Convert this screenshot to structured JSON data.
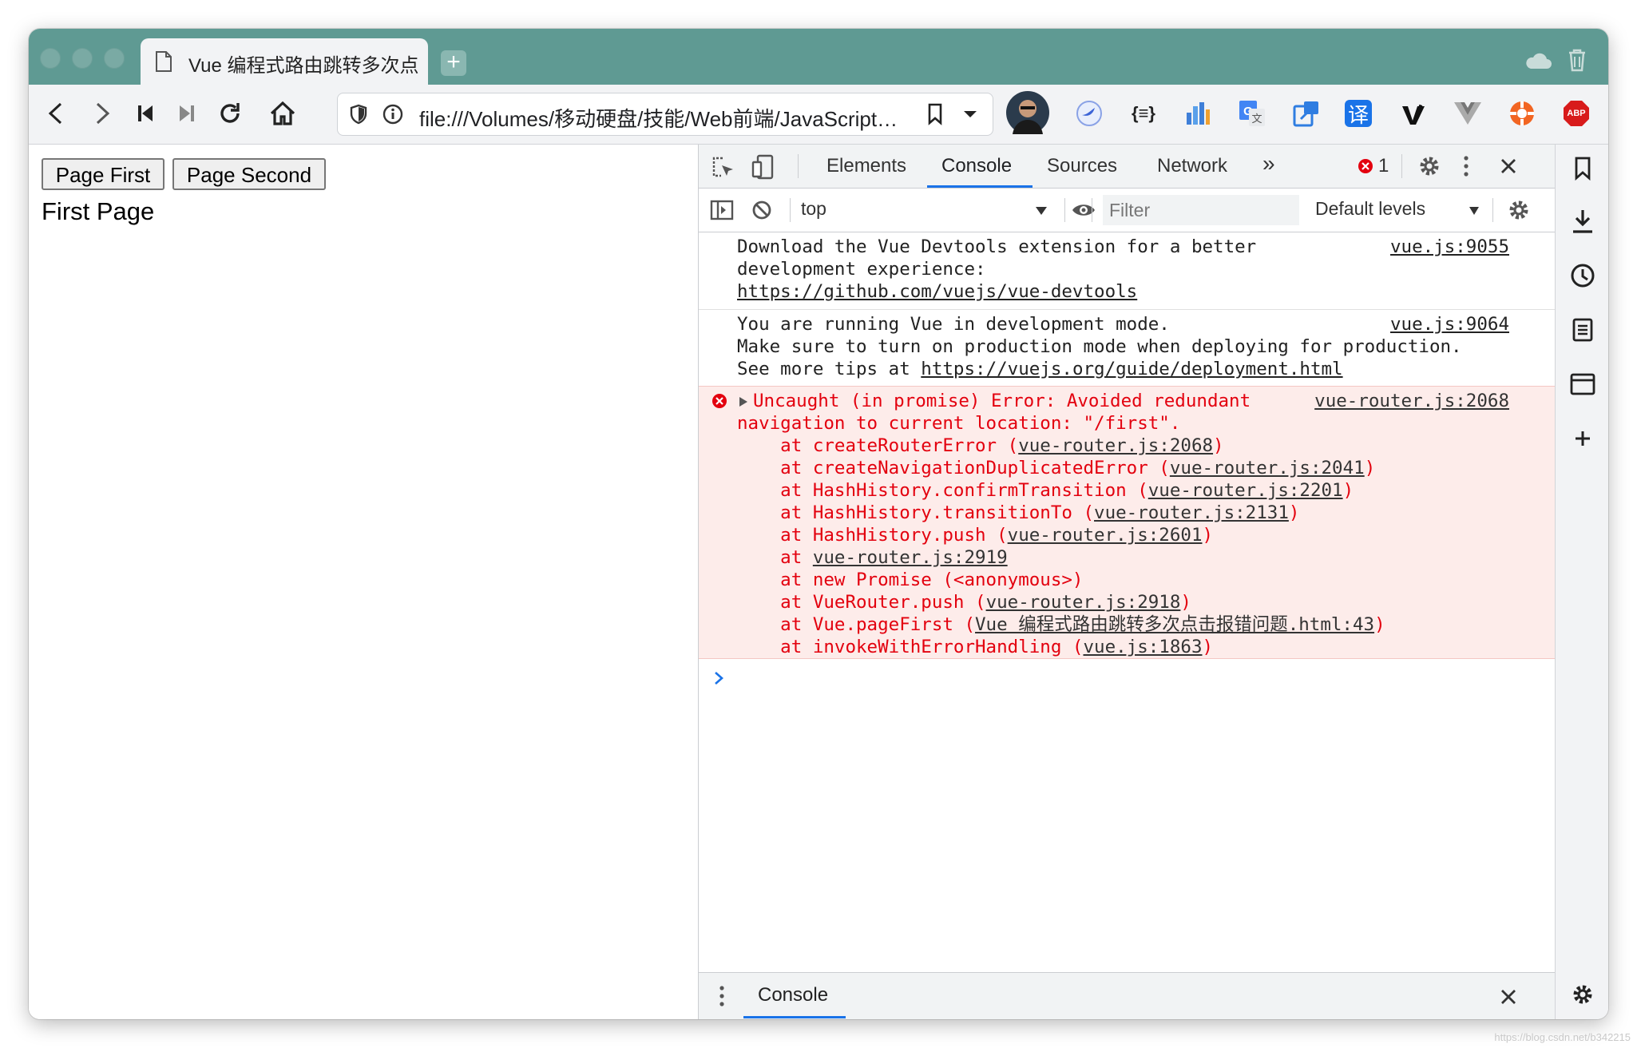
{
  "browser": {
    "tab_title": "Vue 编程式路由跳转多次点",
    "url": "file:///Volumes/移动硬盘/技能/Web前端/JavaScript…",
    "new_tab_label": "+",
    "extensions": [
      "gravatar-avatar",
      "bird-icon",
      "json-icon",
      "chart-icon",
      "translate-icon",
      "share-icon",
      "translate-zh-icon",
      "vimeo-icon",
      "vue-icon",
      "lifebuoy-icon",
      "adblock-icon"
    ],
    "adblock_label": "ABP",
    "json_ext_label": "{≡}",
    "zh_ext_label": "译"
  },
  "page": {
    "button_first": "Page First",
    "button_second": "Page Second",
    "heading": "First Page"
  },
  "devtools": {
    "tabs": [
      "Elements",
      "Console",
      "Sources",
      "Network"
    ],
    "active_tab": "Console",
    "more_tabs": "»",
    "error_count": "1",
    "context": "top",
    "filter_placeholder": "Filter",
    "levels": "Default levels",
    "drawer_tab": "Console",
    "prompt": ">",
    "messages": [
      {
        "lines": [
          "Download the Vue Devtools extension for a better",
          "development experience:"
        ],
        "link": "https://github.com/vuejs/vue-devtools",
        "source": "vue.js:9055"
      },
      {
        "lines": [
          "You are running Vue in development mode.",
          "Make sure to turn on production mode when deploying for production."
        ],
        "prefix": "See more tips at ",
        "link": "https://vuejs.org/guide/deployment.html",
        "source": "vue.js:9064"
      }
    ],
    "error": {
      "line1": "Uncaught (in promise) Error: Avoided redundant",
      "line2": "navigation to current location: \"/first\".",
      "source": "vue-router.js:2068",
      "stack": [
        {
          "pre": "    at createRouterError (",
          "link": "vue-router.js:2068",
          "post": ")"
        },
        {
          "pre": "    at createNavigationDuplicatedError (",
          "link": "vue-router.js:2041",
          "post": ")"
        },
        {
          "pre": "    at HashHistory.confirmTransition (",
          "link": "vue-router.js:2201",
          "post": ")"
        },
        {
          "pre": "    at HashHistory.transitionTo (",
          "link": "vue-router.js:2131",
          "post": ")"
        },
        {
          "pre": "    at HashHistory.push (",
          "link": "vue-router.js:2601",
          "post": ")"
        },
        {
          "pre": "    at ",
          "link": "vue-router.js:2919",
          "post": ""
        },
        {
          "pre": "    at new Promise (<anonymous>)",
          "link": "",
          "post": ""
        },
        {
          "pre": "    at VueRouter.push (",
          "link": "vue-router.js:2918",
          "post": ")"
        },
        {
          "pre": "    at Vue.pageFirst (",
          "link": "Vue 编程式路由跳转多次点击报错问题.html:43",
          "post": ")"
        },
        {
          "pre": "    at invokeWithErrorHandling (",
          "link": "vue.js:1863",
          "post": ")"
        }
      ]
    }
  },
  "watermark": "https://blog.csdn.net/b342215",
  "colors": {
    "titlebar": "#5f9a93",
    "error_text": "#e3000e",
    "error_bg": "#fdecea",
    "accent": "#1a73e8"
  }
}
